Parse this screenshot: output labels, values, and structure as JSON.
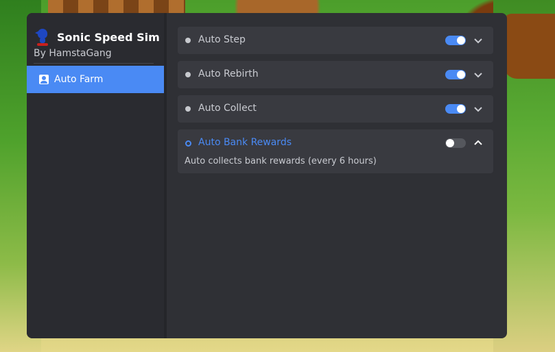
{
  "app": {
    "title": "Sonic Speed Sim",
    "author": "By HamstaGang"
  },
  "sidebar": {
    "items": [
      {
        "label": "Auto Farm",
        "icon": "contact-icon",
        "active": true
      }
    ]
  },
  "features": [
    {
      "label": "Auto Step",
      "enabled": true,
      "expanded": false
    },
    {
      "label": "Auto Rebirth",
      "enabled": true,
      "expanded": false
    },
    {
      "label": "Auto Collect",
      "enabled": true,
      "expanded": false
    },
    {
      "label": "Auto Bank Rewards",
      "enabled": false,
      "expanded": true,
      "description": "Auto collects bank rewards (every 6 hours)"
    }
  ],
  "colors": {
    "accent": "#4a8af4",
    "window_bg": "#2f3035",
    "sidebar_bg": "#2a2b30",
    "card_bg": "#393a40"
  }
}
